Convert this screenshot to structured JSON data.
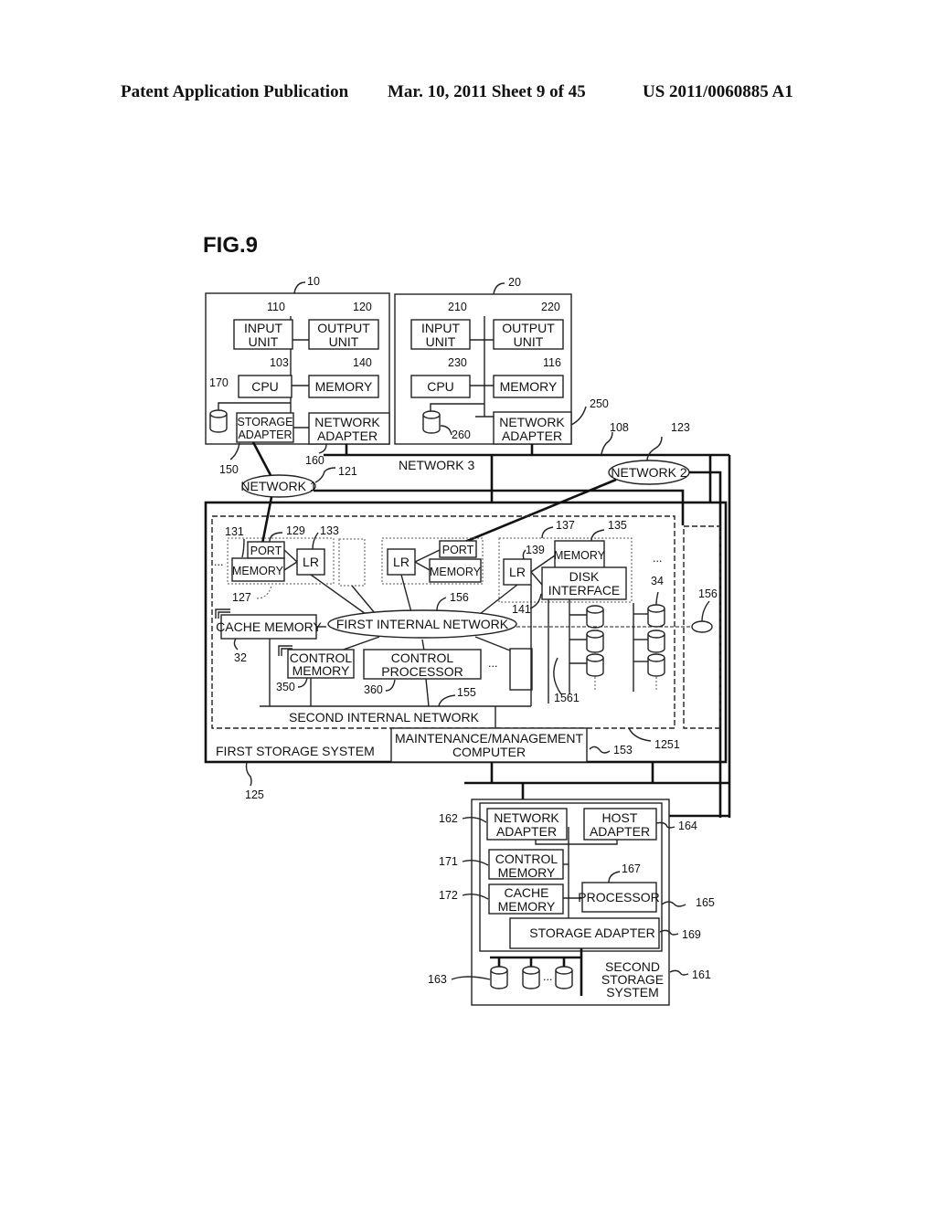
{
  "header": {
    "publication": "Patent Application Publication",
    "date_sheet": "Mar. 10, 2011  Sheet 9 of 45",
    "patent_number": "US 2011/0060885 A1"
  },
  "figure": {
    "title": "FIG.9",
    "host1": {
      "ref": "10",
      "input_unit": [
        "INPUT",
        "UNIT"
      ],
      "input_ref": "110",
      "output_unit": [
        "OUTPUT",
        "UNIT"
      ],
      "output_ref": "120",
      "cpu": "CPU",
      "cpu_ref": "103",
      "memory": "MEMORY",
      "memory_ref": "140",
      "disk_ref": "170",
      "storage_adapter": [
        "STORAGE",
        "ADAPTER"
      ],
      "storage_adapter_ref": "150",
      "network_adapter": [
        "NETWORK",
        "ADAPTER"
      ],
      "network_adapter_ref": "160"
    },
    "host2": {
      "ref": "20",
      "input_unit": [
        "INPUT",
        "UNIT"
      ],
      "input_ref": "210",
      "output_unit": [
        "OUTPUT",
        "UNIT"
      ],
      "output_ref": "220",
      "cpu": "CPU",
      "cpu_ref": "230",
      "memory": "MEMORY",
      "memory_ref": "116",
      "disk_ref": "260",
      "network_adapter": [
        "NETWORK",
        "ADAPTER"
      ],
      "network_adapter_ref": "250"
    },
    "networks": {
      "network1": "NETWORK 1",
      "network1_ref": "121",
      "network2": "NETWORK 2",
      "network2_ref": "123",
      "network3": "NETWORK 3",
      "network3_ref": "108"
    },
    "first_storage": {
      "label": "FIRST STORAGE SYSTEM",
      "ref": "125",
      "inner_ref": "1251",
      "port": "PORT",
      "port_ref": "129",
      "memory": "MEMORY",
      "memory_ref": "131",
      "lr": "LR",
      "lr_ref": "133",
      "package_ref": "127",
      "lr2": "LR",
      "port2": "PORT",
      "memory2": "MEMORY",
      "lr3": "LR",
      "lr3_ref": "139",
      "memory3": "MEMORY",
      "memory3_ref": "135",
      "package3_ref": "137",
      "disk_interface": [
        "DISK",
        "INTERFACE"
      ],
      "disk_interface_ref": "141",
      "disk_ref": "34",
      "first_internal_network": "FIRST INTERNAL NETWORK",
      "first_internal_network_ref": "156",
      "side_network_ref": "156",
      "cache_memory": "CACHE MEMORY",
      "cache_memory_ref": "32",
      "control_memory": [
        "CONTROL",
        "MEMORY"
      ],
      "control_memory_ref": "350",
      "control_processor": [
        "CONTROL",
        "PROCESSOR"
      ],
      "control_processor_ref": "360",
      "second_internal_network": "SECOND INTERNAL NETWORK",
      "second_internal_network_ref": "155",
      "disk_bus_ref": "1561",
      "maintenance": [
        "MAINTENANCE/MANAGEMENT",
        "COMPUTER"
      ],
      "maintenance_ref": "153",
      "ellipsis": "..."
    },
    "second_storage": {
      "label": [
        "SECOND",
        "STORAGE",
        "SYSTEM"
      ],
      "ref": "161",
      "controller_ref": "165",
      "network_adapter": [
        "NETWORK",
        "ADAPTER"
      ],
      "network_adapter_ref": "162",
      "host_adapter": [
        "HOST",
        "ADAPTER"
      ],
      "host_adapter_ref": "164",
      "control_memory": [
        "CONTROL",
        "MEMORY"
      ],
      "control_memory_ref": "171",
      "cache_memory": [
        "CACHE",
        "MEMORY"
      ],
      "cache_memory_ref": "172",
      "processor": "PROCESSOR",
      "processor_ref": "167",
      "storage_adapter": "STORAGE ADAPTER",
      "storage_adapter_ref": "169",
      "disk_ref": "163",
      "ellipsis": "..."
    }
  }
}
